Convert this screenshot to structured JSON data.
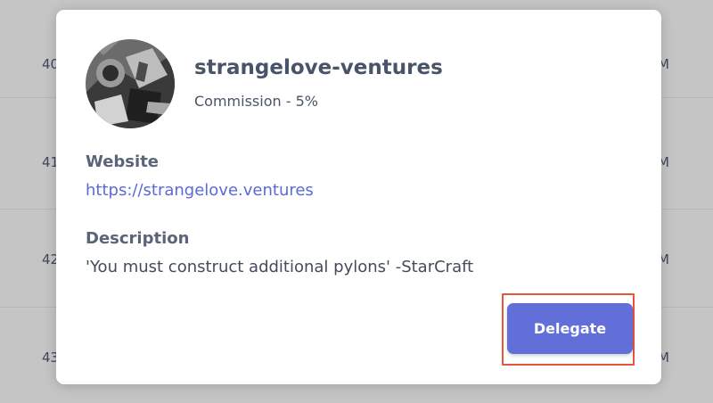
{
  "background": {
    "rows": [
      {
        "left": "40",
        "right": "M"
      },
      {
        "left": "41",
        "right": "M"
      },
      {
        "left": "42",
        "right": "M"
      },
      {
        "left": "43",
        "right": "M"
      }
    ]
  },
  "validator": {
    "name": "strangelove-ventures",
    "commission": "Commission - 5%",
    "avatar_icon": "validator-avatar-icon"
  },
  "website": {
    "label": "Website",
    "url": "https://strangelove.ventures"
  },
  "description": {
    "label": "Description",
    "text": "'You must construct additional pylons' -StarCraft"
  },
  "actions": {
    "delegate_label": "Delegate",
    "highlight_color": "#e8563a",
    "button_color": "#626fd9"
  }
}
